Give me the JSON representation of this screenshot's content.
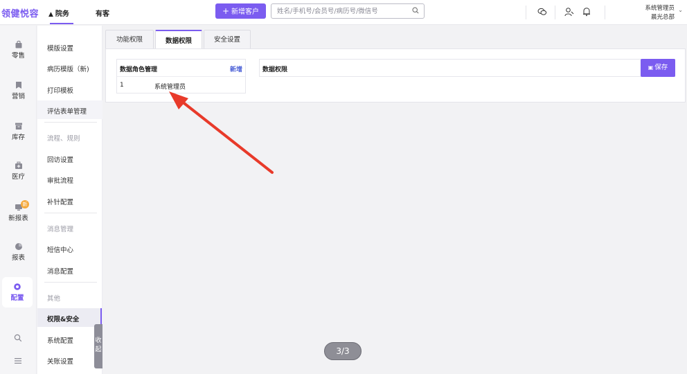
{
  "app": {
    "logo": "领健悦容"
  },
  "topnav": {
    "active": "院务",
    "second": "有客"
  },
  "toolbar": {
    "new_customer": "新增客户",
    "search_placeholder": "姓名/手机号/会员号/病历号/微信号"
  },
  "user": {
    "name": "系统管理员",
    "org": "晨光总部"
  },
  "iconbar": {
    "items": [
      {
        "label": "零售",
        "icon": "bag-icon"
      },
      {
        "label": "营销",
        "icon": "bookmark-icon"
      },
      {
        "label": "库存",
        "icon": "box-icon"
      },
      {
        "label": "医疗",
        "icon": "medical-kit-icon"
      },
      {
        "label": "新报表",
        "icon": "report-icon",
        "badge": "新"
      },
      {
        "label": "报表",
        "icon": "pie-chart-icon"
      },
      {
        "label": "配置",
        "icon": "gear-icon"
      }
    ]
  },
  "submenu": {
    "items": [
      "模版设置",
      "病历模版（新)",
      "打印模板",
      "评估表单管理",
      "流程、规则",
      "回访设置",
      "审批流程",
      "补针配置",
      "消息管理",
      "短信中心",
      "消息配置",
      "其他",
      "权限&安全",
      "系统配置",
      "关账设置"
    ],
    "collapse": "收起"
  },
  "tabs": [
    "功能权限",
    "数据权限",
    "安全设置"
  ],
  "roles": {
    "title": "数据角色管理",
    "add": "新增",
    "rows": [
      {
        "idx": "1",
        "name": "系统管理员"
      }
    ]
  },
  "permissions": {
    "title": "数据权限",
    "save": "保存"
  },
  "pager": "3/3",
  "colors": {
    "accent": "#7b5cf0",
    "arrow": "#e83a2a"
  }
}
